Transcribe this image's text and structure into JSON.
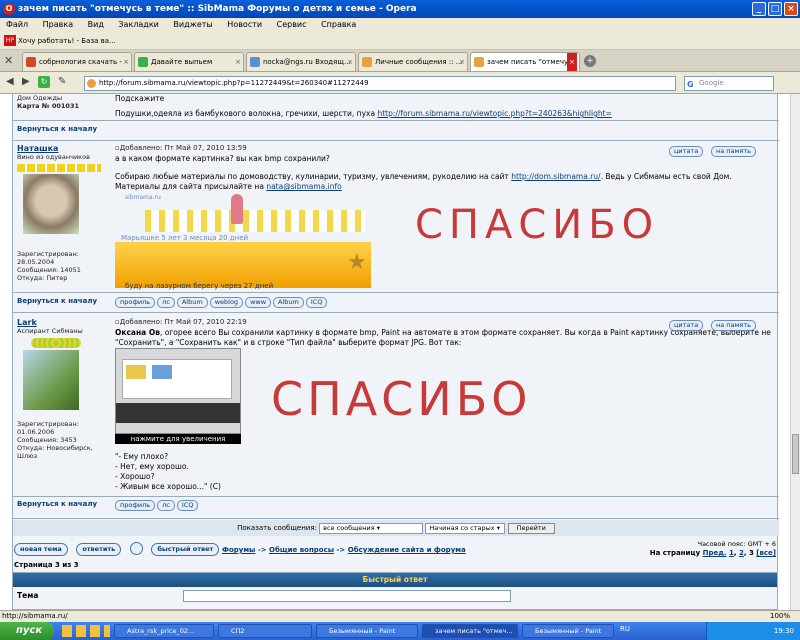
{
  "window": {
    "title": "зачем писать \"отмечусь в теме\" :: SibMama Форумы о детях и семье - Opera"
  },
  "menu": [
    "Файл",
    "Правка",
    "Вид",
    "Закладки",
    "Виджеты",
    "Новости",
    "Сервис",
    "Справка"
  ],
  "bookmark": {
    "label": "Хочу работать! - База ва..."
  },
  "tabs": [
    {
      "label": "собрнология скачать -"
    },
    {
      "label": "Давайте выпьем"
    },
    {
      "label": "nocka@ngs.ru Входящ..."
    },
    {
      "label": "Личные сообщения :: ..."
    },
    {
      "label": "зачем писать \"отмечу..."
    }
  ],
  "address": {
    "url": "http://forum.sibmama.ru/viewtopic.php?p=11272449&t=260340#11272449",
    "search_placeholder": "Google"
  },
  "post0": {
    "user_title": "Дом Одежды",
    "user_card": "Карта № 001031",
    "text1": "Подскажите",
    "text2": "Подушки,одеяла из бамбукового волокна, гречихи, шерсти, пуха",
    "link": "http://forum.sibmama.ru/viewtopic.php?t=240263&highlight="
  },
  "back_label": "Вернуться к началу",
  "post1": {
    "username": "Наташка",
    "user_title": "Вино из одуванчиков",
    "info": [
      "Зарегистрирован:",
      "28.05.2004",
      "Сообщения: 14051",
      "Откуда: Питер"
    ],
    "header": "Добавлено: Пт Май 07, 2010 13:59",
    "question": "а в каком формате картинка? вы как bmp сохранили?",
    "sig1": "Собираю любые материалы по домоводству, кулинарии, туризму, увлечениям, рукоделию на сайт",
    "sig_link": "http://dom.sibmama.ru/",
    "sig2": ". Ведь у Сибмамы есть свой Дом.",
    "sig3": "Материалы для сайта присылайте на",
    "sig_mail": "nata@sibmama.info",
    "banner_site": "sibmama.ru",
    "banner1": "Марьяшке 5 лет 3 месяца 20 дней",
    "banner2": "буду на лазурном берегу через  27 дней",
    "handwriting": "СПАСИБО",
    "buttons": [
      "профиль",
      "лс",
      "Album",
      "weblog",
      "www",
      "Album",
      "ICQ"
    ],
    "quote": "цитата",
    "memory": "на память"
  },
  "post2": {
    "username": "Lark",
    "user_title": "Аспирант Сибманы",
    "info": [
      "Зарегистрирован:",
      "01.06.2006",
      "Сообщения: 3453",
      "Откуда: Новосибирск,",
      "Шлюз"
    ],
    "header": "Добавлено: Пт Май 07, 2010 22:19",
    "author": "Оксана Ов",
    "text": ", огорее всего Вы сохранили картинку в формате bmp, Paint на автомате в этом формате сохраняет. Вы когда в Paint картинку сохраняете, выберите не \"Сохранить\", а \"Сохранить как\" и в строке \"Тип файла\" выберите формат JPG. Вот так:",
    "thumb_caption": "нажмите для увеличения",
    "quote_lines": [
      "\"- Ему плохо?",
      "- Нет, ему хорошо.",
      "- Хорошо?",
      "- Живым все хорошо...\" (С)"
    ],
    "handwriting": "СПАСИБО",
    "buttons": [
      "профиль",
      "лс",
      "ICQ"
    ],
    "quote": "цитата",
    "memory": "на память"
  },
  "filter": {
    "label": "Показать сообщения:",
    "all": "все сообщения",
    "order": "Начиная со старых",
    "go": "Перейти"
  },
  "nav": {
    "new_topic": "новая тема",
    "reply": "ответить",
    "quick_reply": "быстрый ответ",
    "path1": "Форумы",
    "path2": "Общие вопросы",
    "path3": "Обсуждение сайта и форума",
    "timezone": "Часовой пояс: GMT + 6",
    "pages_label": "На страницу",
    "prev": "Пред.",
    "p1": "1",
    "p2": "2",
    "p3": "3",
    "all": "[все]",
    "page_of": "Страница 3 из 3",
    "quick_title": "Быстрый ответ",
    "topic_label": "Тема"
  },
  "status": {
    "url": "http://sibmama.ru/",
    "zoom": "100%"
  },
  "taskbar": {
    "start": "пуск",
    "tasks": [
      "Astra_rsk_price_02...",
      "СП2",
      "Безымянный - Paint",
      "зачем писать \"отмеч...",
      "Безымянный - Paint"
    ],
    "lang": "RU",
    "clock": "19:30"
  }
}
